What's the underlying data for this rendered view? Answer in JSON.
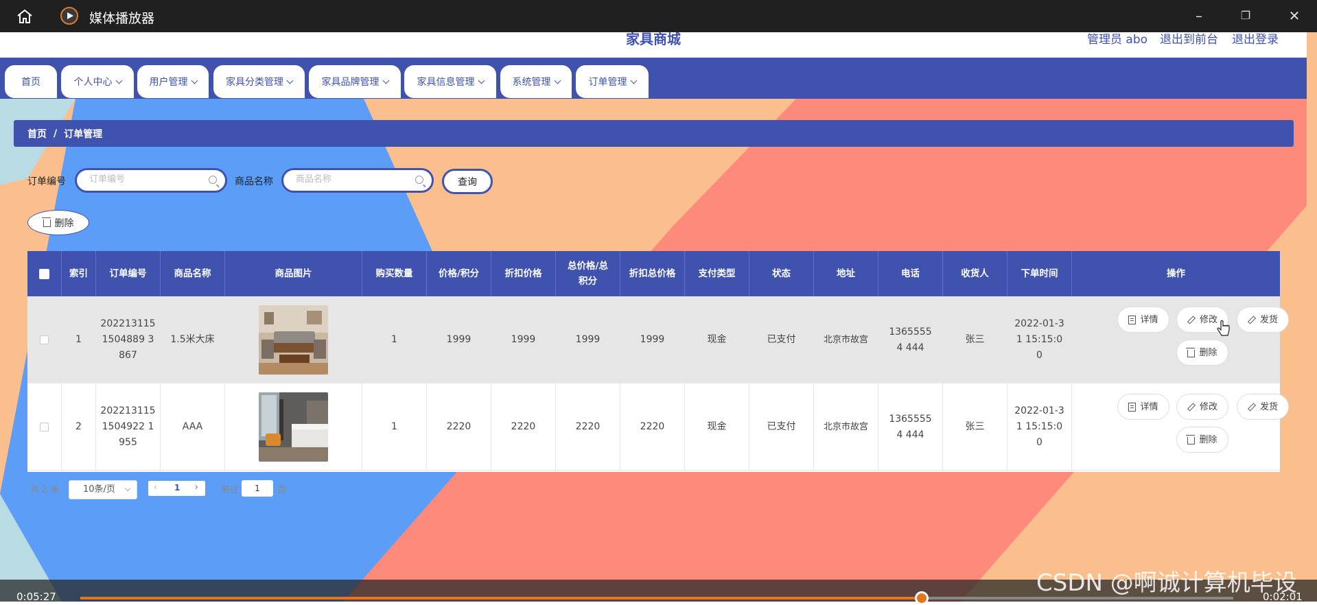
{
  "player": {
    "title": "媒体播放器",
    "time_elapsed": "0:05:27",
    "time_remaining": "0:02:01",
    "progress_fraction": 0.73,
    "accent": "#e4751e"
  },
  "site": {
    "brand": "家具商城",
    "admin": "管理员 abo",
    "to_front": "退出到前台",
    "logout": "退出登录",
    "primary_color": "#3f52ad"
  },
  "nav": {
    "items": [
      {
        "label": "首页",
        "dropdown": false
      },
      {
        "label": "个人中心",
        "dropdown": true
      },
      {
        "label": "用户管理",
        "dropdown": true
      },
      {
        "label": "家具分类管理",
        "dropdown": true
      },
      {
        "label": "家具品牌管理",
        "dropdown": true
      },
      {
        "label": "家具信息管理",
        "dropdown": true
      },
      {
        "label": "系统管理",
        "dropdown": true
      },
      {
        "label": "订单管理",
        "dropdown": true
      }
    ]
  },
  "breadcrumb": {
    "home": "首页",
    "sep": "/",
    "current": "订单管理"
  },
  "search": {
    "order_no_label": "订单编号",
    "order_no_placeholder": "订单编号",
    "product_label": "商品名称",
    "product_placeholder": "商品名称",
    "query_button": "查询",
    "delete_button": "删除"
  },
  "table": {
    "headers": [
      "索引",
      "订单编号",
      "商品名称",
      "商品图片",
      "购买数量",
      "价格/积分",
      "折扣价格",
      "总价格/总积分",
      "折扣总价格",
      "支付类型",
      "状态",
      "地址",
      "电话",
      "收货人",
      "下单时间",
      "操作"
    ],
    "rows": [
      {
        "index": "1",
        "order_no": "2022131151504889 3867",
        "product": "1.5米大床",
        "qty": "1",
        "price": "1999",
        "discount_price": "1999",
        "total": "1999",
        "discount_total": "1999",
        "pay_type": "现金",
        "status": "已支付",
        "address": "北京市故宫",
        "phone": "13655554 444",
        "receiver": "张三",
        "time": "2022-01-3 1 15:15:00"
      },
      {
        "index": "2",
        "order_no": "2022131151504922 1955",
        "product": "AAA",
        "qty": "1",
        "price": "2220",
        "discount_price": "2220",
        "total": "2220",
        "discount_total": "2220",
        "pay_type": "现金",
        "status": "已支付",
        "address": "北京市故宫",
        "phone": "13655554 444",
        "receiver": "张三",
        "time": "2022-01-3 1 15:15:00"
      }
    ],
    "actions": {
      "detail": "详情",
      "edit": "修改",
      "ship": "发货",
      "delete": "删除"
    }
  },
  "pagination": {
    "total": "共 2 条",
    "page_size": "10条/页",
    "current_page": "1",
    "goto_label": "前往",
    "goto_value": "1",
    "page_suffix": "页"
  },
  "watermark": "CSDN @啊诚计算机毕设"
}
